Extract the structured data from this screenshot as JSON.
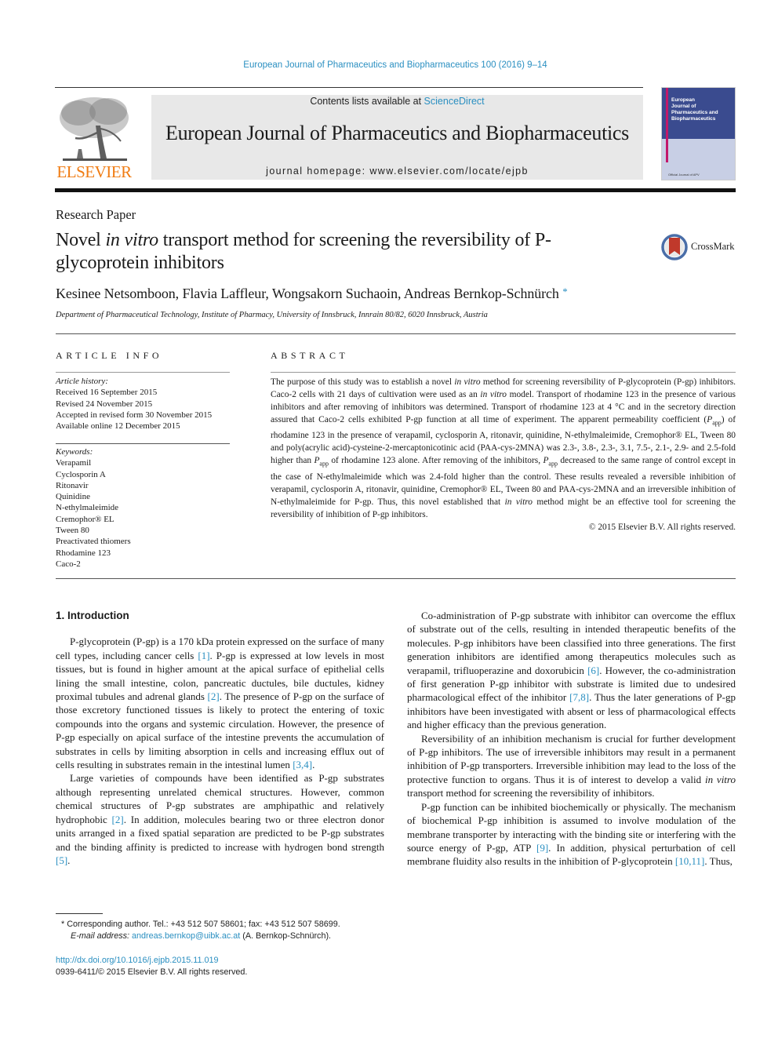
{
  "running_head": "European Journal of Pharmaceutics and Biopharmaceutics 100 (2016) 9–14",
  "publisher": {
    "logo_word": "ELSEVIER",
    "brand_color": "#f07c13"
  },
  "masthead": {
    "contents_prefix": "Contents lists available at ",
    "contents_link": "ScienceDirect",
    "journal_title": "European Journal of Pharmaceutics and Biopharmaceutics",
    "homepage_prefix": "journal homepage: ",
    "homepage_url": "www.elsevier.com/locate/ejpb"
  },
  "cover": {
    "title_lines": [
      "European",
      "Journal of",
      "Pharmaceutics and",
      "Biopharmaceutics"
    ],
    "footer": "Official Journal of APV"
  },
  "article": {
    "type": "Research Paper",
    "title_before": "Novel ",
    "title_italic": "in vitro",
    "title_after": " transport method for screening the reversibility of P-glycoprotein inhibitors",
    "crossmark_label": "CrossMark",
    "authors": "Kesinee Netsomboon, Flavia Laffleur, Wongsakorn Suchaoin, Andreas Bernkop-Schnürch",
    "corresponding_marker": "*",
    "affiliation": "Department of Pharmaceutical Technology, Institute of Pharmacy, University of Innsbruck, Innrain 80/82, 6020 Innsbruck, Austria"
  },
  "article_info": {
    "heading": "ARTICLE INFO",
    "history_label": "Article history:",
    "history": [
      "Received 16 September 2015",
      "Revised 24 November 2015",
      "Accepted in revised form 30 November 2015",
      "Available online 12 December 2015"
    ],
    "keywords_label": "Keywords:",
    "keywords": [
      "Verapamil",
      "Cyclosporin A",
      "Ritonavir",
      "Quinidine",
      "N-ethylmaleimide",
      "Cremophor® EL",
      "Tween 80",
      "Preactivated thiomers",
      "Rhodamine 123",
      "Caco-2"
    ]
  },
  "abstract": {
    "heading": "ABSTRACT",
    "segments": {
      "s1": "The purpose of this study was to establish a novel ",
      "i1": "in vitro",
      "s2": " method for screening reversibility of P-glycoprotein (P-gp) inhibitors. Caco-2 cells with 21 days of cultivation were used as an ",
      "i2": "in vitro",
      "s3": " model. Transport of rhodamine 123 in the presence of various inhibitors and after removing of inhibitors was determined. Transport of rhodamine 123 at 4 °C and in the secretory direction assured that Caco-2 cells exhibited P-gp function at all time of experiment. The apparent permeability coefficient (",
      "p1": "P",
      "sub1": "app",
      "s4": ") of rhodamine 123 in the presence of verapamil, cyclosporin A, ritonavir, quinidine, N-ethylmaleimide, Cremophor® EL, Tween 80 and poly(acrylic acid)-cysteine-2-mercaptonicotinic acid (PAA-cys-2MNA) was 2.3-, 3.8-, 2.3-, 3.1, 7.5-, 2.1-, 2.9- and 2.5-fold higher than ",
      "p2": "P",
      "sub2": "app",
      "s5": " of rhodamine 123 alone. After removing of the inhibitors, ",
      "p3": "P",
      "sub3": "app",
      "s6": " decreased to the same range of control except in the case of N-ethylmaleimide which was 2.4-fold higher than the control. These results revealed a reversible inhibition of verapamil, cyclosporin A, ritonavir, quinidine, Cremophor® EL, Tween 80 and PAA-cys-2MNA and an irreversible inhibition of N-ethylmaleimide for P-gp. Thus, this novel established that ",
      "i3": "in vitro",
      "s7": " method might be an effective tool for screening the reversibility of inhibition of P-gp inhibitors."
    },
    "copyright": "© 2015 Elsevier B.V. All rights reserved."
  },
  "body": {
    "section_heading": "1. Introduction",
    "left": {
      "p1a": "P-glycoprotein (P-gp) is a 170 kDa protein expressed on the surface of many cell types, including cancer cells ",
      "p1r1": "[1]",
      "p1b": ". P-gp is expressed at low levels in most tissues, but is found in higher amount at the apical surface of epithelial cells lining the small intestine, colon, pancreatic ductules, bile ductules, kidney proximal tubules and adrenal glands ",
      "p1r2": "[2]",
      "p1c": ". The presence of P-gp on the surface of those excretory functioned tissues is likely to protect the entering of toxic compounds into the organs and systemic circulation. However, the presence of P-gp especially on apical surface of the intestine prevents the accumulation of substrates in cells by limiting absorption in cells and increasing efflux out of cells resulting in substrates remain in the intestinal lumen ",
      "p1r3": "[3,4]",
      "p1d": ".",
      "p2a": "Large varieties of compounds have been identified as P-gp substrates although representing unrelated chemical structures. However, common chemical structures of P-gp substrates are amphipathic and relatively hydrophobic ",
      "p2r1": "[2]",
      "p2b": ". In addition, molecules bearing two or three electron donor units arranged in a fixed spatial separation are predicted to be P-gp substrates and the binding affinity is predicted to increase with hydrogen bond strength ",
      "p2r2": "[5]",
      "p2c": "."
    },
    "right": {
      "p1a": "Co-administration of P-gp substrate with inhibitor can overcome the efflux of substrate out of the cells, resulting in intended therapeutic benefits of the molecules. P-gp inhibitors have been classified into three generations. The first generation inhibitors are identified among therapeutics molecules such as verapamil, trifluoperazine and doxorubicin ",
      "p1r1": "[6]",
      "p1b": ". However, the co-administration of first generation P-gp inhibitor with substrate is limited due to undesired pharmacological effect of the inhibitor ",
      "p1r2": "[7,8]",
      "p1c": ". Thus the later generations of P-gp inhibitors have been investigated with absent or less of pharmacological effects and higher efficacy than the previous generation.",
      "p2a": "Reversibility of an inhibition mechanism is crucial for further development of P-gp inhibitors. The use of irreversible inhibitors may result in a permanent inhibition of P-gp transporters. Irreversible inhibition may lead to the loss of the protective function to organs. Thus it is of interest to develop a valid ",
      "p2i": "in vitro",
      "p2b": " transport method for screening the reversibility of inhibitors.",
      "p3a": "P-gp function can be inhibited biochemically or physically. The mechanism of biochemical P-gp inhibition is assumed to involve modulation of the membrane transporter by interacting with the binding site or interfering with the source energy of P-gp, ATP ",
      "p3r1": "[9]",
      "p3b": ". In addition, physical perturbation of cell membrane fluidity also results in the inhibition of P-glycoprotein ",
      "p3r2": "[10,11]",
      "p3c": ". Thus,"
    }
  },
  "footnote": {
    "marker": "*",
    "line1": "Corresponding author. Tel.: +43 512 507 58601; fax: +43 512 507 58699.",
    "email_label": "E-mail address: ",
    "email": "andreas.bernkop@uibk.ac.at",
    "email_suffix": " (A. Bernkop-Schnürch)."
  },
  "doi": {
    "url": "http://dx.doi.org/10.1016/j.ejpb.2015.11.019",
    "issn_line": "0939-6411/© 2015 Elsevier B.V. All rights reserved."
  }
}
